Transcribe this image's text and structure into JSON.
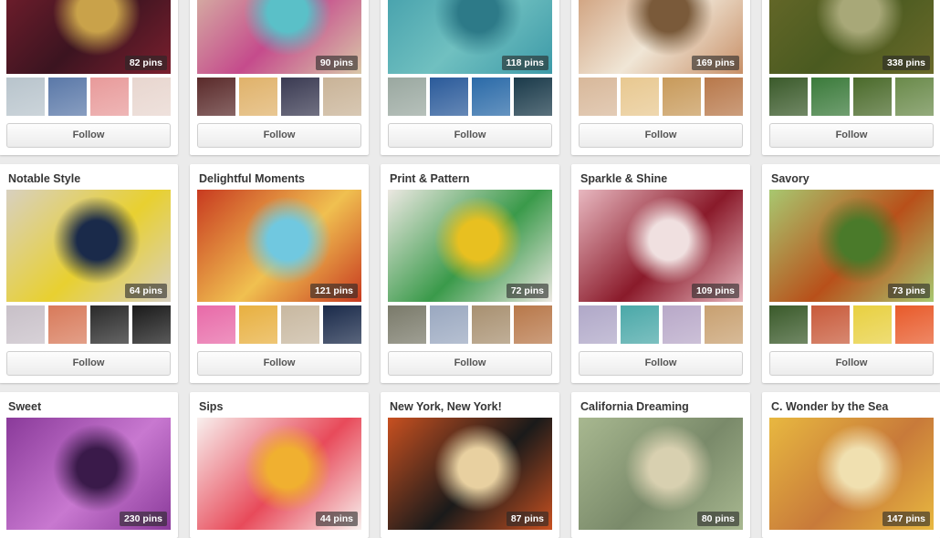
{
  "follow_label": "Follow",
  "boards": [
    {
      "col": 0,
      "row": 0,
      "title": "",
      "pins": "82 pins",
      "cover": [
        "#7a1f2e",
        "#3b1420",
        "#c9a24a"
      ],
      "thumbs": [
        "#b8c4cc",
        "#5a78a8",
        "#e89a9a",
        "#e8d6cf"
      ]
    },
    {
      "col": 1,
      "row": 0,
      "title": "",
      "pins": "90 pins",
      "cover": [
        "#d9c7a8",
        "#c54b8c",
        "#5ac0c8"
      ],
      "thumbs": [
        "#5a2a2a",
        "#e0b26a",
        "#3a3a52",
        "#c9b397"
      ]
    },
    {
      "col": 2,
      "row": 0,
      "title": "",
      "pins": "118 pins",
      "cover": [
        "#3d9aa8",
        "#70c0c0",
        "#2d7a88"
      ],
      "thumbs": [
        "#9aa8a0",
        "#2a5a9a",
        "#2a6aa8",
        "#1a3a4a"
      ]
    },
    {
      "col": 3,
      "row": 0,
      "title": "",
      "pins": "169 pins",
      "cover": [
        "#c89068",
        "#f0e6d6",
        "#7a5a3a"
      ],
      "thumbs": [
        "#d8b89a",
        "#e8c890",
        "#c89a5a",
        "#b8784a"
      ]
    },
    {
      "col": 4,
      "row": 0,
      "title": "",
      "pins": "338 pins",
      "cover": [
        "#6a6a2a",
        "#4a5a20",
        "#a8a878"
      ],
      "thumbs": [
        "#3a5a2a",
        "#3a7a3a",
        "#4a6a2a",
        "#6a8a4a"
      ]
    },
    {
      "col": 0,
      "row": 1,
      "title": "Notable Style",
      "pins": "64 pins",
      "cover": [
        "#d8d0c0",
        "#e8d030",
        "#1a2a4a"
      ],
      "thumbs": [
        "#c8c0c8",
        "#d87a5a",
        "#2a2a2a",
        "#1a1a1a"
      ]
    },
    {
      "col": 1,
      "row": 1,
      "title": "Delightful Moments",
      "pins": "121 pins",
      "cover": [
        "#c83a20",
        "#f0c050",
        "#70c8e0"
      ],
      "thumbs": [
        "#e86aa8",
        "#e8b040",
        "#c8b8a0",
        "#1a2a4a"
      ]
    },
    {
      "col": 2,
      "row": 1,
      "title": "Print & Pattern",
      "pins": "72 pins",
      "cover": [
        "#ece8e2",
        "#3a9a4a",
        "#e8c020"
      ],
      "thumbs": [
        "#7a7a6a",
        "#9aa8c0",
        "#a89070",
        "#b8784a"
      ]
    },
    {
      "col": 3,
      "row": 1,
      "title": "Sparkle & Shine",
      "pins": "109 pins",
      "cover": [
        "#e8b8c0",
        "#8a1a2a",
        "#f0e0e0"
      ],
      "thumbs": [
        "#b0a8c8",
        "#4aa8a8",
        "#b8a8c8",
        "#c8a070"
      ]
    },
    {
      "col": 4,
      "row": 1,
      "title": "Savory",
      "pins": "73 pins",
      "cover": [
        "#a8c870",
        "#b8501a",
        "#4a7a2a"
      ],
      "thumbs": [
        "#3a5a2a",
        "#c85a3a",
        "#e8d040",
        "#e85a2a"
      ]
    },
    {
      "col": 0,
      "row": 2,
      "title": "Sweet",
      "pins": "230 pins",
      "cover": [
        "#8a3a9a",
        "#c878d0",
        "#3a1a4a"
      ],
      "thumbs": []
    },
    {
      "col": 1,
      "row": 2,
      "title": "Sips",
      "pins": "44 pins",
      "cover": [
        "#f8f0ee",
        "#e84a5a",
        "#f0b030"
      ],
      "thumbs": []
    },
    {
      "col": 2,
      "row": 2,
      "title": "New York, New York!",
      "pins": "87 pins",
      "cover": [
        "#c85020",
        "#1a1a1a",
        "#e8d0a0"
      ],
      "thumbs": []
    },
    {
      "col": 3,
      "row": 2,
      "title": "California Dreaming",
      "pins": "80 pins",
      "cover": [
        "#a8b890",
        "#7a8a6a",
        "#d8d0b0"
      ],
      "thumbs": []
    },
    {
      "col": 4,
      "row": 2,
      "title": "C. Wonder by the Sea",
      "pins": "147 pins",
      "cover": [
        "#e8b840",
        "#c87a3a",
        "#f0e0b0"
      ],
      "thumbs": []
    }
  ]
}
